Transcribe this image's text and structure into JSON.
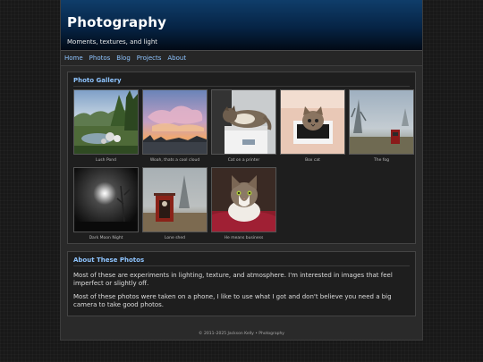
{
  "site": {
    "title": "Photography",
    "tagline": "Moments, textures, and light"
  },
  "nav": {
    "items": [
      "Home",
      "Photos",
      "Blog",
      "Projects",
      "About"
    ]
  },
  "gallery": {
    "heading": "Photo Gallery",
    "photos": [
      {
        "caption": "Lush Pond",
        "subject": "pond with trees and stones"
      },
      {
        "caption": "Woah, thats a cool cloud",
        "subject": "pink sunset clouds"
      },
      {
        "caption": "Cat on a printer",
        "subject": "tabby cat lying on a printer"
      },
      {
        "caption": "Box cat",
        "subject": "cat peeking out of a box"
      },
      {
        "caption": "The fog",
        "subject": "foggy field with red box"
      },
      {
        "caption": "Dark Moon Night",
        "subject": "glowing moon in dark fog"
      },
      {
        "caption": "Lone shed",
        "subject": "red shed in foggy yard"
      },
      {
        "caption": "He means business",
        "subject": "tabby cat on red blanket"
      }
    ]
  },
  "about": {
    "heading": "About These Photos",
    "paragraphs": [
      "Most of these are experiments in lighting, texture, and atmosphere. I'm interested in images that feel imperfect or slightly off.",
      "Most of these photos were taken on a phone, I like to use what I got and don't believe you need a big camera to take good photos."
    ]
  },
  "footer": {
    "text": "© 2011–2025 Jackson Kelly • Photography"
  },
  "colors": {
    "link": "#8ec4ff",
    "header_top": "#0f3d6a",
    "header_bottom": "#020a16",
    "page_bg": "#2a2a2a"
  }
}
